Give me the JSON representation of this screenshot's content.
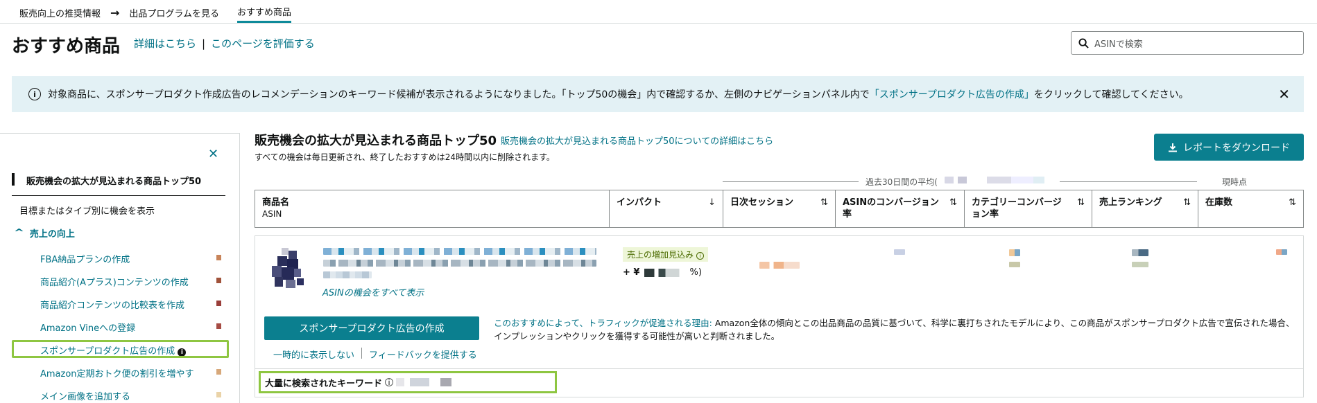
{
  "breadcrumb": {
    "items": [
      "販売向上の推奨情報",
      "出品プログラムを見る",
      "おすすめ商品"
    ],
    "arrow": "→"
  },
  "header": {
    "title": "おすすめ商品",
    "details_link": "詳細はこちら",
    "separator": "|",
    "rate_link": "このページを評価する"
  },
  "search": {
    "placeholder": "ASINで検索",
    "icon": "search-icon"
  },
  "banner": {
    "text_main": "対象商品に、スポンサープロダクト作成広告のレコメンデーションのキーワード候補が表示されるようになりました。「トップ50の機会」内で確認するか、左側のナビゲーションパネル内で",
    "text_link": "「スポンサープロダクト広告の作成」",
    "text_tail": "をクリックして確認してください。",
    "close": "✕"
  },
  "sidebar": {
    "close": "✕",
    "active": "販売機会の拡大が見込まれる商品トップ50",
    "filter": "目標またはタイプ別に機会を表示",
    "group": "売上の向上",
    "group_chevron": "^",
    "items": [
      {
        "label": "FBA納品プランの作成",
        "color": "#c8845a"
      },
      {
        "label": "商品紹介(Aプラス)コンテンツの作成",
        "color": "#a0523a"
      },
      {
        "label": "商品紹介コンテンツの比較表を作成",
        "color": "#9a3e3a"
      },
      {
        "label": "Amazon Vineへの登録",
        "color": "#a64c44"
      },
      {
        "label": "スポンサープロダクト広告の作成",
        "color": ""
      },
      {
        "label": "Amazon定期おトク便の割引を増やす",
        "color": "#d7a87a"
      },
      {
        "label": "メイン画像を追加する",
        "color": "#ead3a8"
      }
    ]
  },
  "main": {
    "title": "販売機会の拡大が見込まれる商品トップ50",
    "title_link": "販売機会の拡大が見込まれる商品トップ50についての詳細はこちら",
    "subtitle": "すべての機会は毎日更新され、終了したおすすめは24時間以内に削除されます。",
    "download_button": "レポートをダウンロード",
    "avg_label": "過去30日間の平均(",
    "now_label": "現時点"
  },
  "table": {
    "columns": [
      {
        "label": "商品名",
        "sub": "ASIN",
        "sort": ""
      },
      {
        "label": "インパクト",
        "sub": "",
        "sort": "↓"
      },
      {
        "label": "日次セッション",
        "sub": "",
        "sort": "⇅"
      },
      {
        "label": "ASINのコンバージョン率",
        "sub": "",
        "sort": "⇅"
      },
      {
        "label": "カテゴリーコンバージョン率",
        "sub": "",
        "sort": "⇅"
      },
      {
        "label": "売上ランキング",
        "sub": "",
        "sort": "⇅"
      },
      {
        "label": "在庫数",
        "sub": "",
        "sort": "⇅"
      }
    ]
  },
  "card": {
    "asin_link": "ASINの機会をすべて表示",
    "impact_label": "売上の増加見込み",
    "impact_prefix": "+ ¥",
    "impact_suffix": "%)",
    "sp_button": "スポンサープロダクト広告の作成",
    "hide_link": "一時的に表示しない",
    "feedback_link": "フィードバックを提供する",
    "reason_lead": "このおすすめによって、トラフィックが促進される理由:",
    "reason_text": " Amazon全体の傾向とこの出品商品の品質に基づいて、科学に裏打ちされたモデルにより、この商品がスポンサープロダクト広告で宣伝された場合、インプレッションやクリックを獲得する可能性が高いと判断されました。",
    "keyword_label": "大量に検索されたキーワード"
  }
}
